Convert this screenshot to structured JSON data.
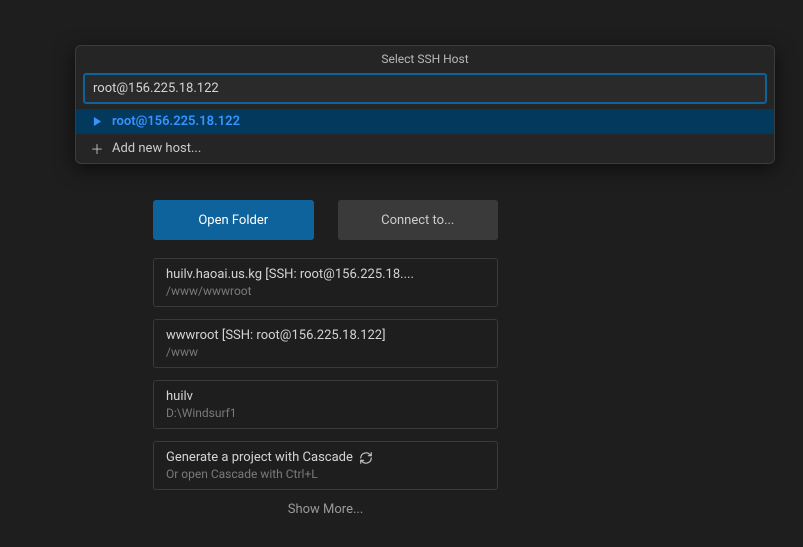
{
  "palette": {
    "title": "Select SSH Host",
    "input_value": "root@156.225.18.122",
    "items": [
      {
        "icon": "▶",
        "label": "root@156.225.18.122",
        "selected": true
      },
      {
        "icon": "＋",
        "label": "Add new host...",
        "selected": false
      }
    ]
  },
  "welcome": {
    "open_folder_label": "Open Folder",
    "connect_to_label": "Connect to...",
    "recents": [
      {
        "title": "huilv.haoai.us.kg [SSH: root@156.225.18....",
        "sub": "/www/wwwroot"
      },
      {
        "title": "wwwroot [SSH: root@156.225.18.122]",
        "sub": "/www"
      },
      {
        "title": "huilv",
        "sub": "D:\\Windsurf1"
      }
    ],
    "cascade": {
      "title": "Generate a project with Cascade",
      "sub": "Or open Cascade with Ctrl+L"
    },
    "show_more_label": "Show More..."
  }
}
